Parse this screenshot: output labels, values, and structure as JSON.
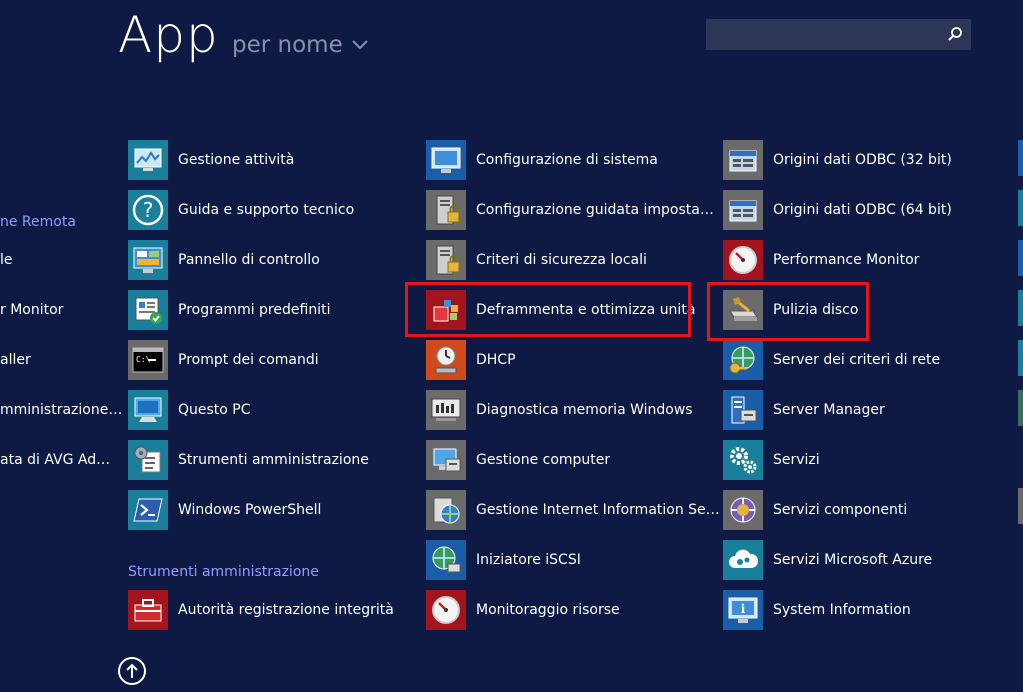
{
  "header": {
    "title": "App",
    "sort_label": "per nome",
    "search_placeholder": ""
  },
  "left_partial": {
    "group_header": "ne Remota",
    "items": [
      "le",
      "r Monitor",
      "aller",
      "mministrazione…",
      "ata di AVG Ad…"
    ]
  },
  "columns": {
    "col1": [
      {
        "label": "Gestione attività",
        "icon": "task-manager-icon"
      },
      {
        "label": "Guida e supporto tecnico",
        "icon": "help-icon"
      },
      {
        "label": "Pannello di controllo",
        "icon": "control-panel-icon"
      },
      {
        "label": "Programmi predefiniti",
        "icon": "default-programs-icon"
      },
      {
        "label": "Prompt dei comandi",
        "icon": "command-prompt-icon"
      },
      {
        "label": "Questo PC",
        "icon": "this-pc-icon"
      },
      {
        "label": "Strumenti amministrazione",
        "icon": "admin-tools-icon"
      },
      {
        "label": "Windows PowerShell",
        "icon": "powershell-icon"
      }
    ],
    "col1_group_header": "Strumenti amministrazione",
    "col1_group_items": [
      {
        "label": "Autorità registrazione integrità",
        "icon": "toolbox-icon"
      }
    ],
    "col2": [
      {
        "label": "Configurazione di sistema",
        "icon": "system-config-icon"
      },
      {
        "label": "Configurazione guidata imposta…",
        "icon": "security-wizard-icon"
      },
      {
        "label": "Criteri di sicurezza locali",
        "icon": "local-security-policy-icon"
      },
      {
        "label": "Deframmenta e ottimizza unità",
        "icon": "defrag-icon"
      },
      {
        "label": "DHCP",
        "icon": "dhcp-icon"
      },
      {
        "label": "Diagnostica memoria Windows",
        "icon": "memory-diagnostic-icon"
      },
      {
        "label": "Gestione computer",
        "icon": "computer-management-icon"
      },
      {
        "label": "Gestione Internet Information Se…",
        "icon": "iis-manager-icon"
      },
      {
        "label": "Iniziatore iSCSI",
        "icon": "iscsi-icon"
      },
      {
        "label": "Monitoraggio risorse",
        "icon": "resource-monitor-icon"
      }
    ],
    "col3": [
      {
        "label": "Origini dati ODBC (32 bit)",
        "icon": "odbc-icon"
      },
      {
        "label": "Origini dati ODBC (64 bit)",
        "icon": "odbc-icon"
      },
      {
        "label": "Performance Monitor",
        "icon": "performance-monitor-icon"
      },
      {
        "label": "Pulizia disco",
        "icon": "disk-cleanup-icon"
      },
      {
        "label": "Server dei criteri di rete",
        "icon": "network-policy-icon"
      },
      {
        "label": "Server Manager",
        "icon": "server-manager-icon"
      },
      {
        "label": "Servizi",
        "icon": "services-icon"
      },
      {
        "label": "Servizi componenti",
        "icon": "component-services-icon"
      },
      {
        "label": "Servizi Microsoft Azure",
        "icon": "azure-icon"
      },
      {
        "label": "System Information",
        "icon": "system-information-icon"
      }
    ]
  },
  "colors": {
    "background": "#0f1a44",
    "highlight": "#e8141c",
    "group_header": "#8e9fff"
  }
}
